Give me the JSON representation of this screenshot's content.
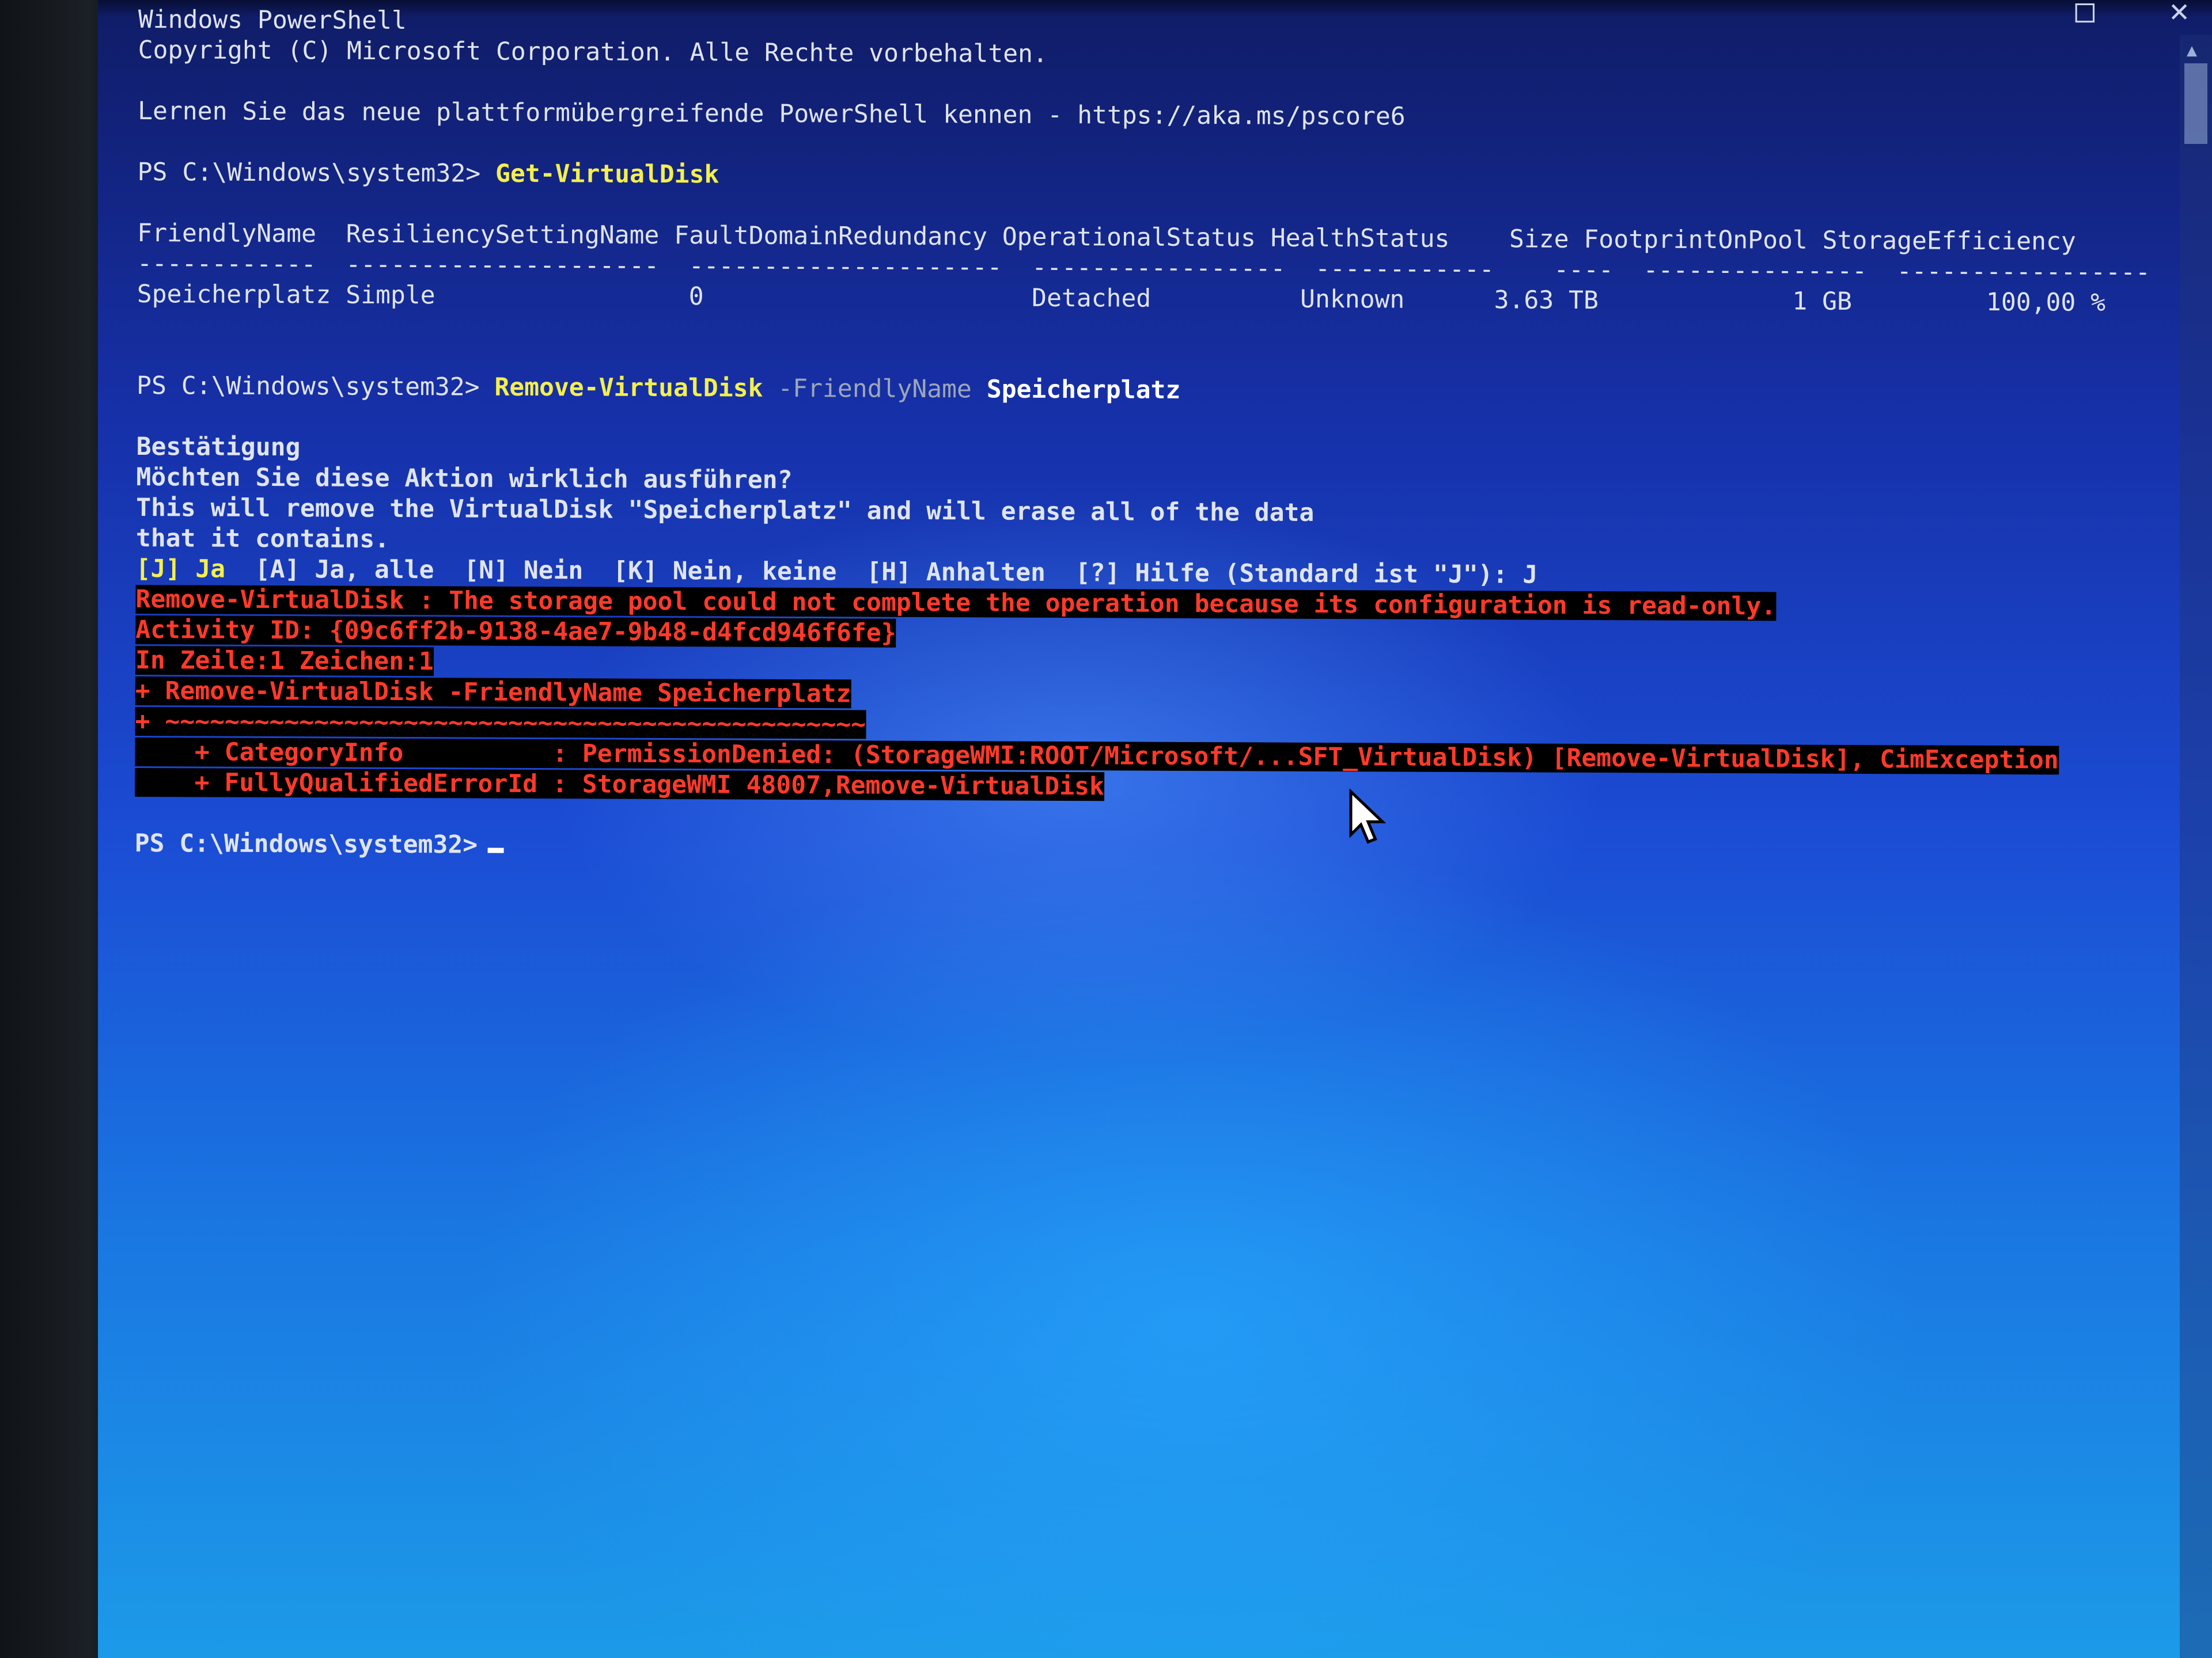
{
  "window": {
    "title": "Windows PowerShell",
    "copyright": "Copyright (C) Microsoft Corporation. Alle Rechte vorbehalten.",
    "pscore_hint": "Lernen Sie das neue plattformübergreifende PowerShell kennen - https://aka.ms/pscore6",
    "controls": [
      "□",
      "✕"
    ]
  },
  "prompt": "PS C:\\Windows\\system32>",
  "command1": {
    "name": "Get-VirtualDisk"
  },
  "table": {
    "headers": [
      "FriendlyName",
      "ResiliencySettingName",
      "FaultDomainRedundancy",
      "OperationalStatus",
      "HealthStatus",
      "Size",
      "FootprintOnPool",
      "StorageEfficiency"
    ],
    "separator": "------------  ---------------------  ---------------------  -----------------  ------------    ----  ---------------  -----------------",
    "row": [
      "Speicherplatz",
      "Simple",
      "0",
      "Detached",
      "Unknown",
      "3.63 TB",
      "1 GB",
      "100,00 %"
    ]
  },
  "command2": {
    "name": "Remove-VirtualDisk",
    "param": "-FriendlyName",
    "arg": "Speicherplatz"
  },
  "confirm": {
    "title": "Bestätigung",
    "question": "Möchten Sie diese Aktion wirklich ausführen?",
    "message1": "This will remove the VirtualDisk \"Speicherplatz\" and will erase all of the data",
    "message2": "that it contains.",
    "default_choice": "[J] Ja",
    "choices": "  [A] Ja, alle  [N] Nein  [K] Nein, keine  [H] Anhalten  [?] Hilfe (Standard ist \"J\"): J"
  },
  "error": {
    "line1": "Remove-VirtualDisk : The storage pool could not complete the operation because its configuration is read-only.",
    "line2": "Activity ID: {09c6ff2b-9138-4ae7-9b48-d4fcd946f6fe}",
    "line3": "In Zeile:1 Zeichen:1",
    "line4": "+ Remove-VirtualDisk -FriendlyName Speicherplatz",
    "line5": "+ ~~~~~~~~~~~~~~~~~~~~~~~~~~~~~~~~~~~~~~~~~~~~~~~",
    "line6": "    + CategoryInfo          : PermissionDenied: (StorageWMI:ROOT/Microsoft/...SFT_VirtualDisk) [Remove-VirtualDisk], CimException",
    "line7": "    + FullyQualifiedErrorId : StorageWMI 48007,Remove-VirtualDisk"
  },
  "colors": {
    "command": "#f4ef4d",
    "error_fg": "#ff3a2a",
    "error_bg": "#000000",
    "text": "#dfe4ee"
  },
  "icons": [
    "mouse-pointer-icon",
    "maximize-icon",
    "close-icon"
  ]
}
